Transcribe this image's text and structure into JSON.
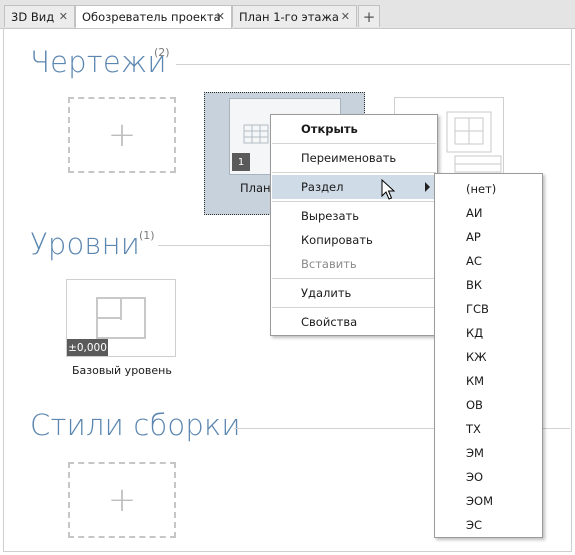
{
  "tabs": [
    {
      "label": "3D Вид",
      "active": false
    },
    {
      "label": "Обозреватель проекта",
      "active": true
    },
    {
      "label": "План 1-го этажа",
      "active": false
    }
  ],
  "add_tab_label": "+",
  "sections": {
    "drawings": {
      "title": "Чертежи",
      "count": "(2)"
    },
    "levels": {
      "title": "Уровни",
      "count": "(1)"
    },
    "styles": {
      "title": "Стили сборки"
    }
  },
  "add_placeholder": "+",
  "drawing_thumbnail": {
    "label": "План",
    "sheet_number": "1"
  },
  "level_thumbnail": {
    "label": "Базовый уровень",
    "elevation": "±0,000"
  },
  "context_menu": {
    "open": "Открыть",
    "rename": "Переименовать",
    "section": "Раздел",
    "cut": "Вырезать",
    "copy": "Копировать",
    "paste": "Вставить",
    "delete": "Удалить",
    "properties": "Свойства"
  },
  "section_submenu": [
    "(нет)",
    "АИ",
    "АР",
    "АС",
    "ВК",
    "ГСВ",
    "КД",
    "КЖ",
    "КМ",
    "ОВ",
    "ТХ",
    "ЭМ",
    "ЭО",
    "ЭОМ",
    "ЭС"
  ],
  "colors": {
    "section_title": "#5b86b0",
    "selection_bg": "#c8d2dc",
    "menu_hover": "#cfdbe6",
    "badge_bg": "#5a5a5a"
  }
}
